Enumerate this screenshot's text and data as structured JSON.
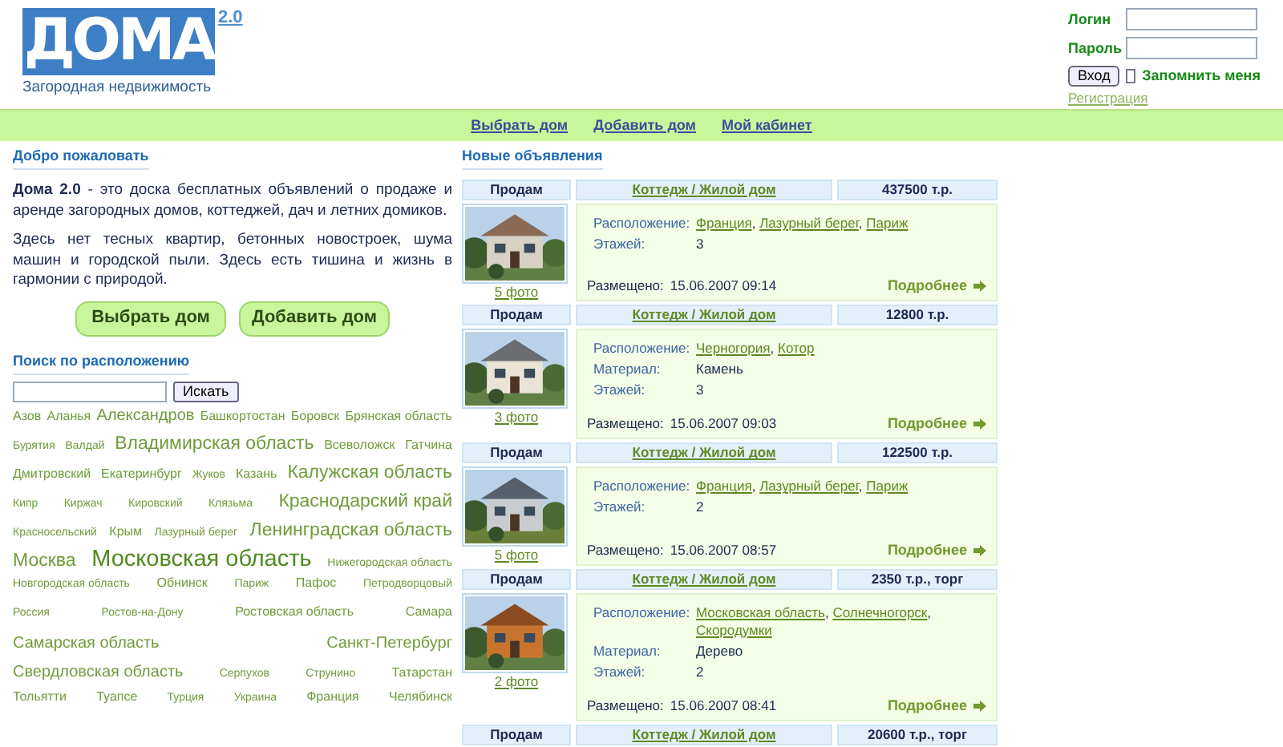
{
  "logo": {
    "title": "ДОМА",
    "version": "2.0",
    "subtitle": "Загородная недвижимость"
  },
  "login": {
    "login_label": "Логин",
    "password_label": "Пароль",
    "submit": "Вход",
    "remember": {
      "label": "Запомнить меня",
      "checked": false
    },
    "register": "Регистрация"
  },
  "nav": [
    "Выбрать дом",
    "Добавить дом",
    "Мой кабинет"
  ],
  "welcome": {
    "title": "Добро пожаловать",
    "paragraphs": [
      "**Дома 2.0** - это доска бесплатных объявлений о продаже и аренде загородных домов, коттеджей, дач и летних домиков.",
      "Здесь нет тесных квартир, бетонных новостроек, шума машин и городской пыли. Здесь есть тишина и жизнь в гармонии с природой."
    ],
    "buttons": [
      "Выбрать дом",
      "Добавить дом"
    ]
  },
  "search": {
    "title": "Поиск по расположению",
    "button": "Искать"
  },
  "tag_rows": [
    [
      {
        "text": "Азов",
        "kind": "s"
      },
      {
        "text": "Аланья",
        "kind": "s"
      },
      {
        "text": "Александров",
        "kind": "m"
      },
      {
        "text": "Башкортостан",
        "kind": "s"
      },
      {
        "text": "Боровск",
        "kind": "s"
      },
      {
        "text": "Брянская область",
        "kind": "s"
      }
    ],
    [
      {
        "text": "Бурятия",
        "kind": "xs"
      },
      {
        "text": "Валдай",
        "kind": "xs"
      },
      {
        "text": "Владимирская область",
        "kind": "l"
      },
      {
        "text": "Всеволожск",
        "kind": "s"
      },
      {
        "text": "Гатчина",
        "kind": "s"
      }
    ],
    [
      {
        "text": "Дмитровский",
        "kind": "s"
      },
      {
        "text": "Екатеринбург",
        "kind": "s"
      },
      {
        "text": "Жуков",
        "kind": "xs"
      },
      {
        "text": "Казань",
        "kind": "s"
      },
      {
        "text": "Калужская область",
        "kind": "l"
      }
    ],
    [
      {
        "text": "Кипр",
        "kind": "xs"
      },
      {
        "text": "Киржач",
        "kind": "xs"
      },
      {
        "text": "Кировский",
        "kind": "xs"
      },
      {
        "text": "Клязьма",
        "kind": "xs"
      },
      {
        "text": "Краснодарский край",
        "kind": "l"
      }
    ],
    [
      {
        "text": "Красносельский",
        "kind": "xs"
      },
      {
        "text": "Крым",
        "kind": "s"
      },
      {
        "text": "Лазурный берег",
        "kind": "xs"
      },
      {
        "text": "Ленинградская область",
        "kind": "l"
      }
    ],
    [
      {
        "text": "Москва",
        "kind": "l"
      },
      {
        "text": "Московская область",
        "kind": "xl"
      },
      {
        "text": "Нижегородская область",
        "kind": "xs"
      }
    ],
    [
      {
        "text": "Новгородская область",
        "kind": "xs"
      },
      {
        "text": "Обнинск",
        "kind": "s"
      },
      {
        "text": "Париж",
        "kind": "xs"
      },
      {
        "text": "Пафос",
        "kind": "s"
      },
      {
        "text": "Петродворцовый",
        "kind": "xs"
      }
    ],
    [
      {
        "text": "Россия",
        "kind": "xs"
      },
      {
        "text": "Ростов-на-Дону",
        "kind": "xs"
      },
      {
        "text": "Ростовская область",
        "kind": "s"
      },
      {
        "text": "Самара",
        "kind": "s"
      }
    ],
    [
      {
        "text": "Самарская область",
        "kind": "m"
      },
      {
        "text": "Санкт-Петербург",
        "kind": "m"
      }
    ],
    [
      {
        "text": "Свердловская область",
        "kind": "m"
      },
      {
        "text": "Серпухов",
        "kind": "xs"
      },
      {
        "text": "Струнино",
        "kind": "xs"
      },
      {
        "text": "Татарстан",
        "kind": "s"
      }
    ],
    [
      {
        "text": "Тольятти",
        "kind": "s"
      },
      {
        "text": "Туапсе",
        "kind": "s"
      },
      {
        "text": "Турция",
        "kind": "xs"
      },
      {
        "text": "Украина",
        "kind": "xs"
      },
      {
        "text": "Франция",
        "kind": "s"
      },
      {
        "text": "Челябинск",
        "kind": "s"
      }
    ]
  ],
  "listings_title": "Новые объявления",
  "listings": [
    {
      "deal": "Продам",
      "type": "Коттедж / Жилой дом",
      "price": "437500 т.р.",
      "photos": "5 фото",
      "fields": [
        {
          "label": "Расположение:",
          "links": [
            "Франция",
            "Лазурный берег",
            "Париж"
          ],
          "separator": ","
        },
        {
          "label": "Этажей:",
          "value": "3"
        }
      ],
      "posted_label": "Размещено:",
      "posted": "15.06.2007 09:14",
      "more": "Подробнее"
    },
    {
      "deal": "Продам",
      "type": "Коттедж / Жилой дом",
      "price": "12800 т.р.",
      "photos": "3 фото",
      "fields": [
        {
          "label": "Расположение:",
          "links": [
            "Черногория",
            "Котор"
          ],
          "separator": ","
        },
        {
          "label": "Материал:",
          "value": "Камень"
        },
        {
          "label": "Этажей:",
          "value": "3"
        }
      ],
      "posted_label": "Размещено:",
      "posted": "15.06.2007 09:03",
      "more": "Подробнее"
    },
    {
      "deal": "Продам",
      "type": "Коттедж / Жилой дом",
      "price": "122500 т.р.",
      "photos": "5 фото",
      "fields": [
        {
          "label": "Расположение:",
          "links": [
            "Франция",
            "Лазурный берег",
            "Париж"
          ],
          "separator": ","
        },
        {
          "label": "Этажей:",
          "value": "2"
        }
      ],
      "posted_label": "Размещено:",
      "posted": "15.06.2007 08:57",
      "more": "Подробнее"
    },
    {
      "deal": "Продам",
      "type": "Коттедж / Жилой дом",
      "price": "2350 т.р., торг",
      "photos": "2 фото",
      "fields": [
        {
          "label": "Расположение:",
          "links": [
            "Московская область",
            "Солнечногорск",
            "Скородумки"
          ],
          "separator": ","
        },
        {
          "label": "Материал:",
          "value": "Дерево"
        },
        {
          "label": "Этажей:",
          "value": "2"
        }
      ],
      "posted_label": "Размещено:",
      "posted": "15.06.2007 08:41",
      "more": "Подробнее"
    },
    {
      "deal": "Продам",
      "type": "Коттедж / Жилой дом",
      "price": "20600 т.р., торг"
    }
  ]
}
